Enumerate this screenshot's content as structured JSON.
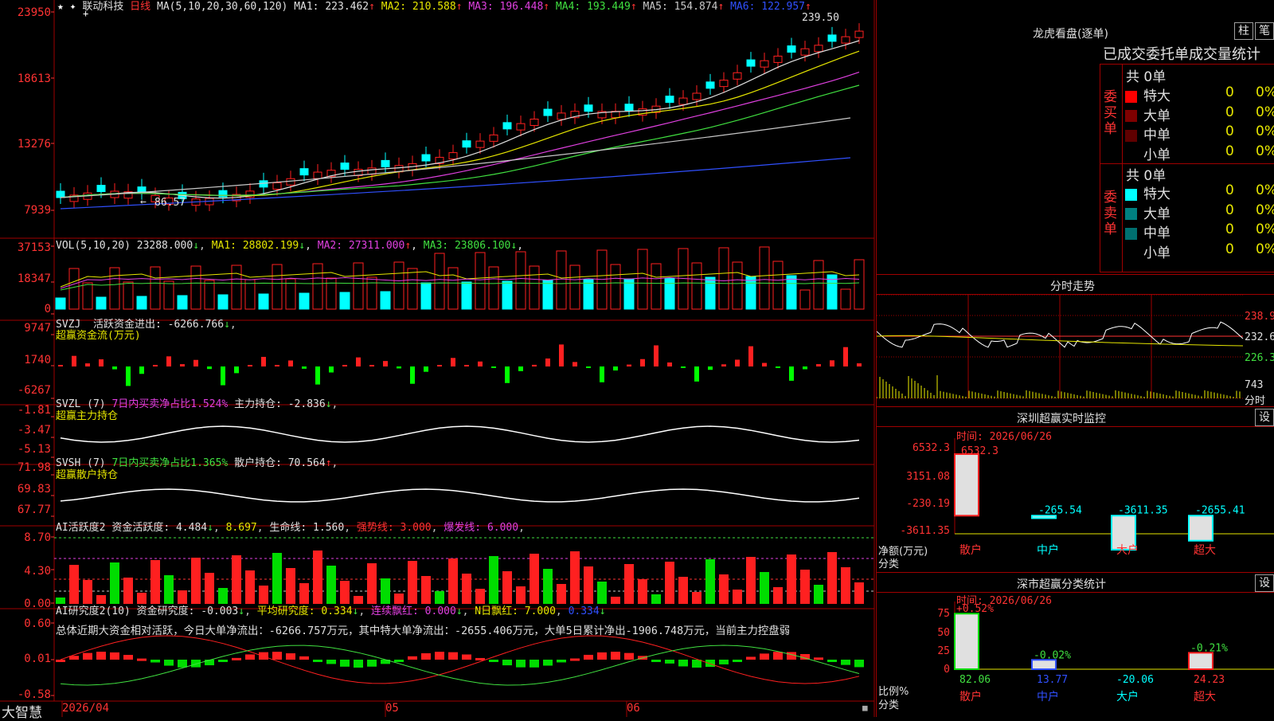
{
  "stock": {
    "name": "联动科技",
    "period": "日线"
  },
  "kline": {
    "ma_label": "MA(5,10,20,30,60,120)",
    "ma": [
      {
        "label": "MA1: 223.462",
        "arrow": "↑",
        "color": "#e0e0e0"
      },
      {
        "label": "MA2: 210.588",
        "arrow": "↑",
        "color": "#e6e600"
      },
      {
        "label": "MA3: 196.448",
        "arrow": "↑",
        "color": "#e040e0"
      },
      {
        "label": "MA4: 193.449",
        "arrow": "↑",
        "color": "#40e040"
      },
      {
        "label": "MA5: 154.874",
        "arrow": "↑",
        "color": "#c8c8c8"
      },
      {
        "label": "MA6: 122.957",
        "arrow": "↑",
        "color": "#3050ff"
      }
    ],
    "y_labels": [
      "23950",
      "18613",
      "13276",
      "7939"
    ],
    "high_mark": "239.50",
    "low_mark": "86.57"
  },
  "volume": {
    "label": "VOL(5,10,20)",
    "value": "23288.000",
    "value_arrow": "↓",
    "ma": [
      {
        "label": "MA1: 28802.199",
        "arrow": "↓",
        "color": "#e6e600"
      },
      {
        "label": "MA2: 27311.000",
        "arrow": "↑",
        "color": "#e040e0"
      },
      {
        "label": "MA3: 23806.100",
        "arrow": "↓",
        "color": "#40e040"
      }
    ],
    "y_labels": [
      "37153",
      "18347",
      "0"
    ]
  },
  "svzj": {
    "label": "SVZJ",
    "text": "活跃资金进出: -6266.766",
    "arrow": "↓",
    "sub": "超赢资金流(万元)",
    "y_labels": [
      "9747",
      "1740",
      "-6267"
    ]
  },
  "svzl": {
    "label": "SVZL (7)",
    "highlight": "7日内买卖净占比1.524%",
    "text": "主力持仓: -2.836",
    "arrow": "↓",
    "sub": "超赢主力持仓",
    "y_labels": [
      "-1.81",
      "-3.47",
      "-5.13"
    ]
  },
  "svsh": {
    "label": "SVSH (7)",
    "highlight": "7日内买卖净占比1.365%",
    "text": "散户持仓: 70.564",
    "arrow": "↑",
    "sub": "超赢散户持仓",
    "y_labels": [
      "71.98",
      "69.83",
      "67.77"
    ]
  },
  "ai_active": {
    "label": "AI活跃度2",
    "text1": "资金活跃度: 4.484",
    "arrow1": "↓",
    "text2": "8.697",
    "text3": "生命线: 1.560",
    "text4": "强势线: 3.000",
    "text5": "爆发线: 6.000",
    "y_labels": [
      "8.70",
      "4.30",
      "0.00"
    ]
  },
  "ai_research": {
    "label": "AI研究度2(10)",
    "text1": "资金研究度: -0.003",
    "arrow1": "↓",
    "text2": "平均研究度: 0.334",
    "arrow2": "↓",
    "text3": "连续飘红: 0.000",
    "arrow3": "↓",
    "text4": "N日飘红: 7.000",
    "text5": "0.334",
    "comment": "总体近期大资金相对活跃，今日大单净流出：-6266.757万元，其中特大单净流出：-2655.406万元，大单5日累计净出-1906.748万元，当前主力控盘弱",
    "y_labels": [
      "0.60",
      "0.01",
      "-0.58"
    ]
  },
  "bottom": {
    "brand": "大智慧",
    "dates": [
      "2026/04",
      "05",
      "06"
    ]
  },
  "dragon": {
    "title": "龙虎看盘(逐单)",
    "btn_bar": "柱",
    "btn_pen": "笔",
    "tabs": "已成交委托单成交量统计",
    "buy": {
      "side": "委买单",
      "total": "共 0单",
      "rows": [
        {
          "label": "特大",
          "count": "0",
          "pct": "0%",
          "color": "#ff0000"
        },
        {
          "label": "大单",
          "count": "0",
          "pct": "0%",
          "color": "#800000"
        },
        {
          "label": "中单",
          "count": "0",
          "pct": "0%",
          "color": "#600000"
        },
        {
          "label": "小单",
          "count": "0",
          "pct": "0%",
          "color": ""
        }
      ]
    },
    "sell": {
      "side": "委卖单",
      "total": "共 0单",
      "rows": [
        {
          "label": "特大",
          "count": "0",
          "pct": "0%",
          "color": "#00ffff"
        },
        {
          "label": "大单",
          "count": "0",
          "pct": "0%",
          "color": "#008080"
        },
        {
          "label": "中单",
          "count": "0",
          "pct": "0%",
          "color": "#007070"
        },
        {
          "label": "小单",
          "count": "0",
          "pct": "0%",
          "color": ""
        }
      ]
    }
  },
  "intraday": {
    "title": "分时走势",
    "labels": [
      "238.9",
      "232.6",
      "226.3",
      "743"
    ],
    "unit": "分时"
  },
  "sz_monitor": {
    "title": "深圳超赢实时监控",
    "btn": "设",
    "time": "时间: 2026/06/26",
    "y_labels": [
      "6532.3",
      "3151.08",
      "-230.19",
      "-3611.35"
    ],
    "unit": "净额(万元)",
    "cat_label": "分类",
    "categories": [
      "散户",
      "中户",
      "大户",
      "超大"
    ],
    "values": [
      6532.3,
      -265.54,
      -3611.35,
      -2655.41
    ],
    "value_labels": [
      "6532.3",
      "-265.54",
      "-3611.35",
      "-2655.41"
    ]
  },
  "sz_stats": {
    "title": "深市超赢分类统计",
    "btn": "设",
    "time": "时间: 2026/06/26",
    "y_labels": [
      "75",
      "50",
      "25",
      "0"
    ],
    "unit": "比例%",
    "cat_label": "分类",
    "categories": [
      "散户",
      "中户",
      "大户",
      "超大"
    ],
    "bar_values": [
      82.06,
      13.77,
      0,
      24.23
    ],
    "pct_labels": [
      "+0.52%",
      "-0.02%",
      "",
      "-0.21%"
    ],
    "bottom_values": [
      "82.06",
      "13.77",
      "-20.06",
      "24.23"
    ]
  },
  "colors": {
    "up": "#ff2020",
    "down": "#00ffff",
    "grid": "#a00000"
  }
}
